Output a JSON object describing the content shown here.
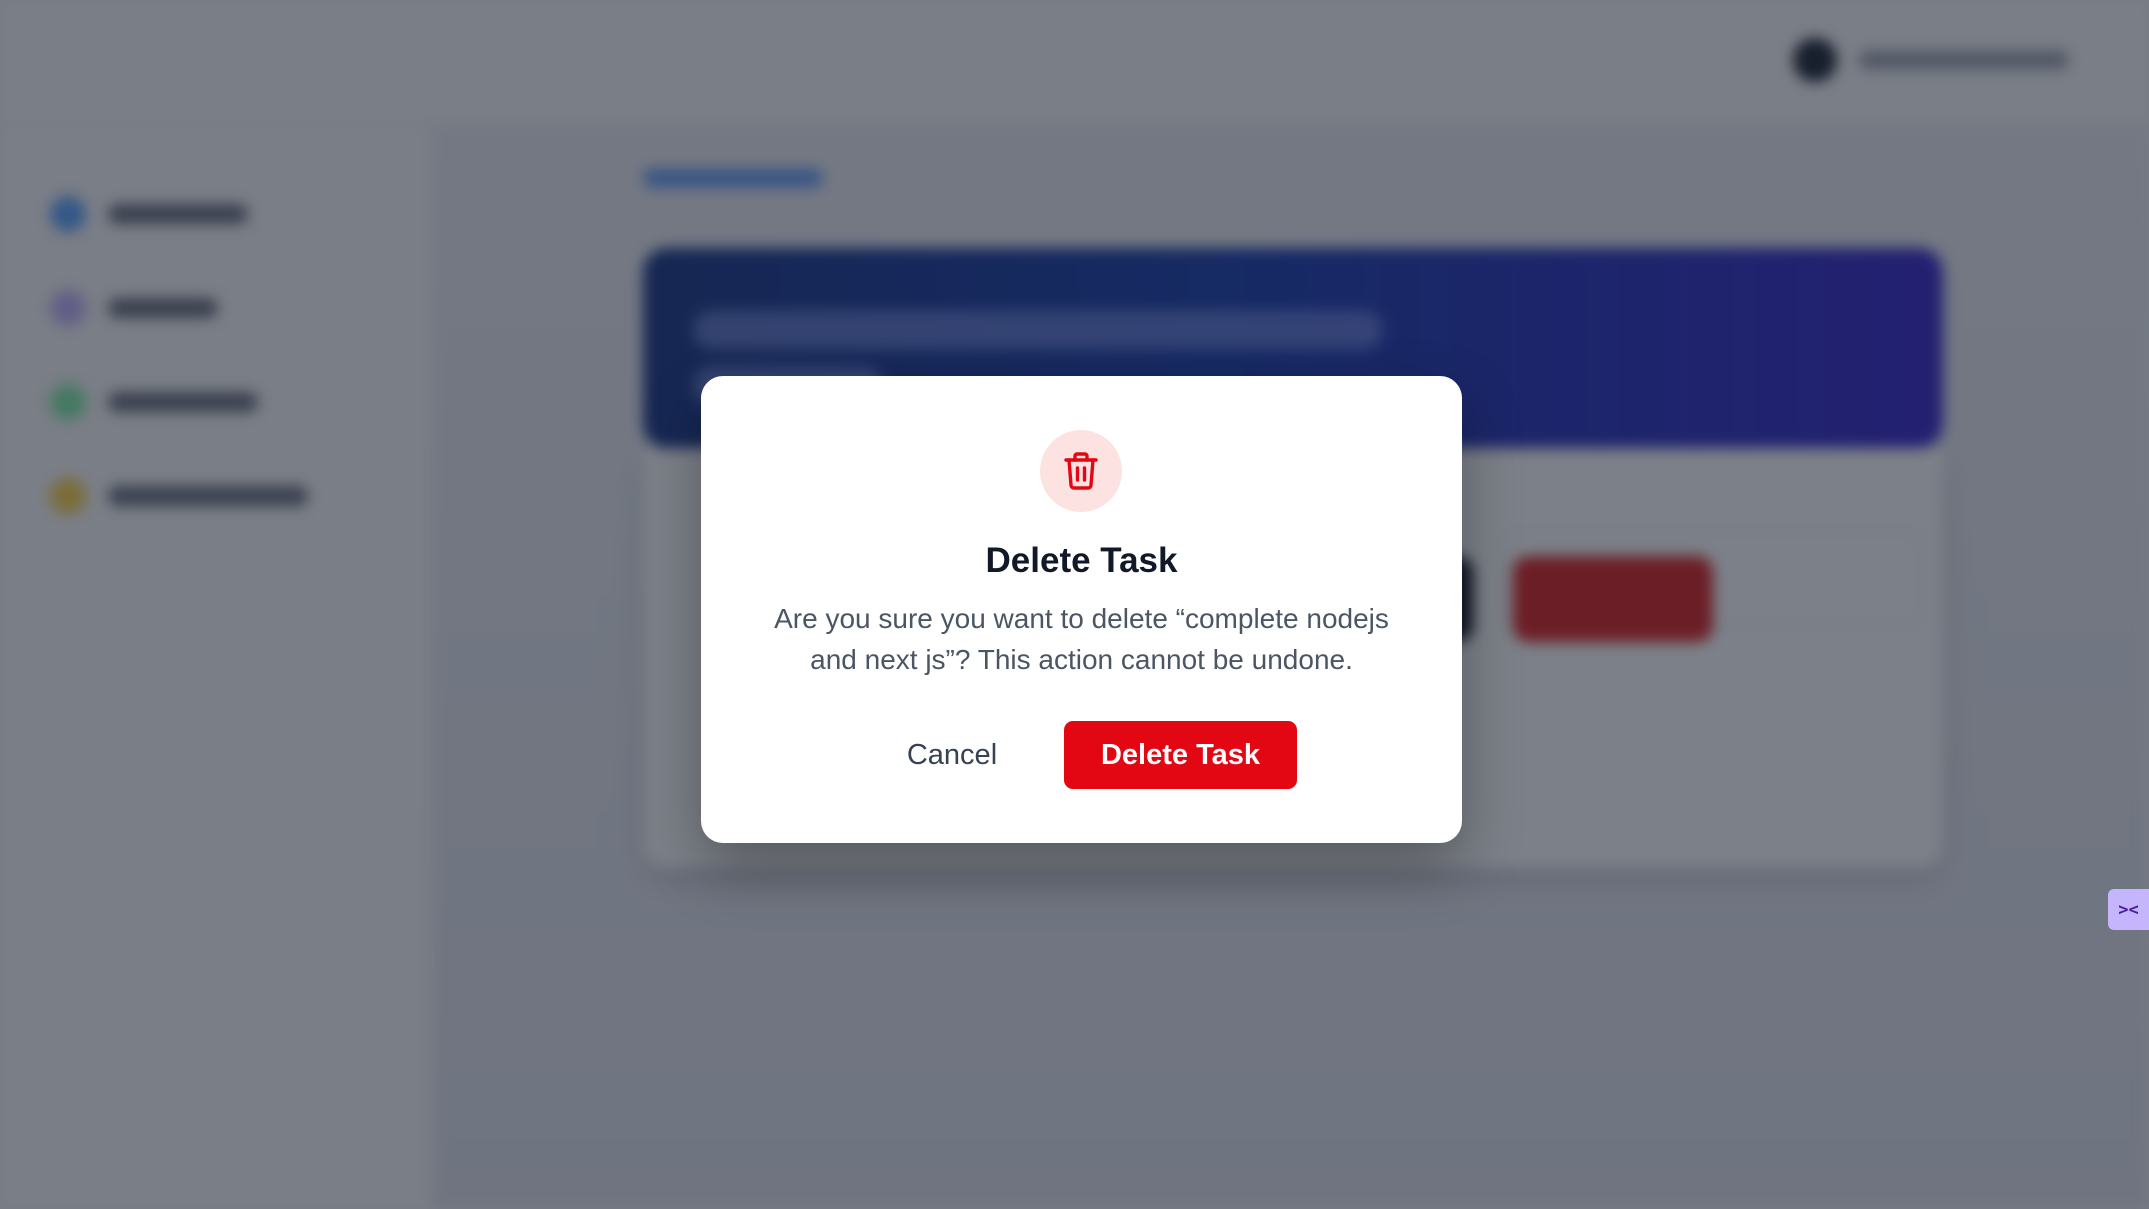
{
  "modal": {
    "icon": "trash-icon",
    "title": "Delete Task",
    "message": "Are you sure you want to delete “complete nodejs and next js”? This action cannot be undone.",
    "cancel_label": "Cancel",
    "confirm_label": "Delete Task"
  },
  "colors": {
    "danger": "#e30613",
    "danger_soft": "#fde2e2",
    "brand": "#1d4ed8"
  }
}
